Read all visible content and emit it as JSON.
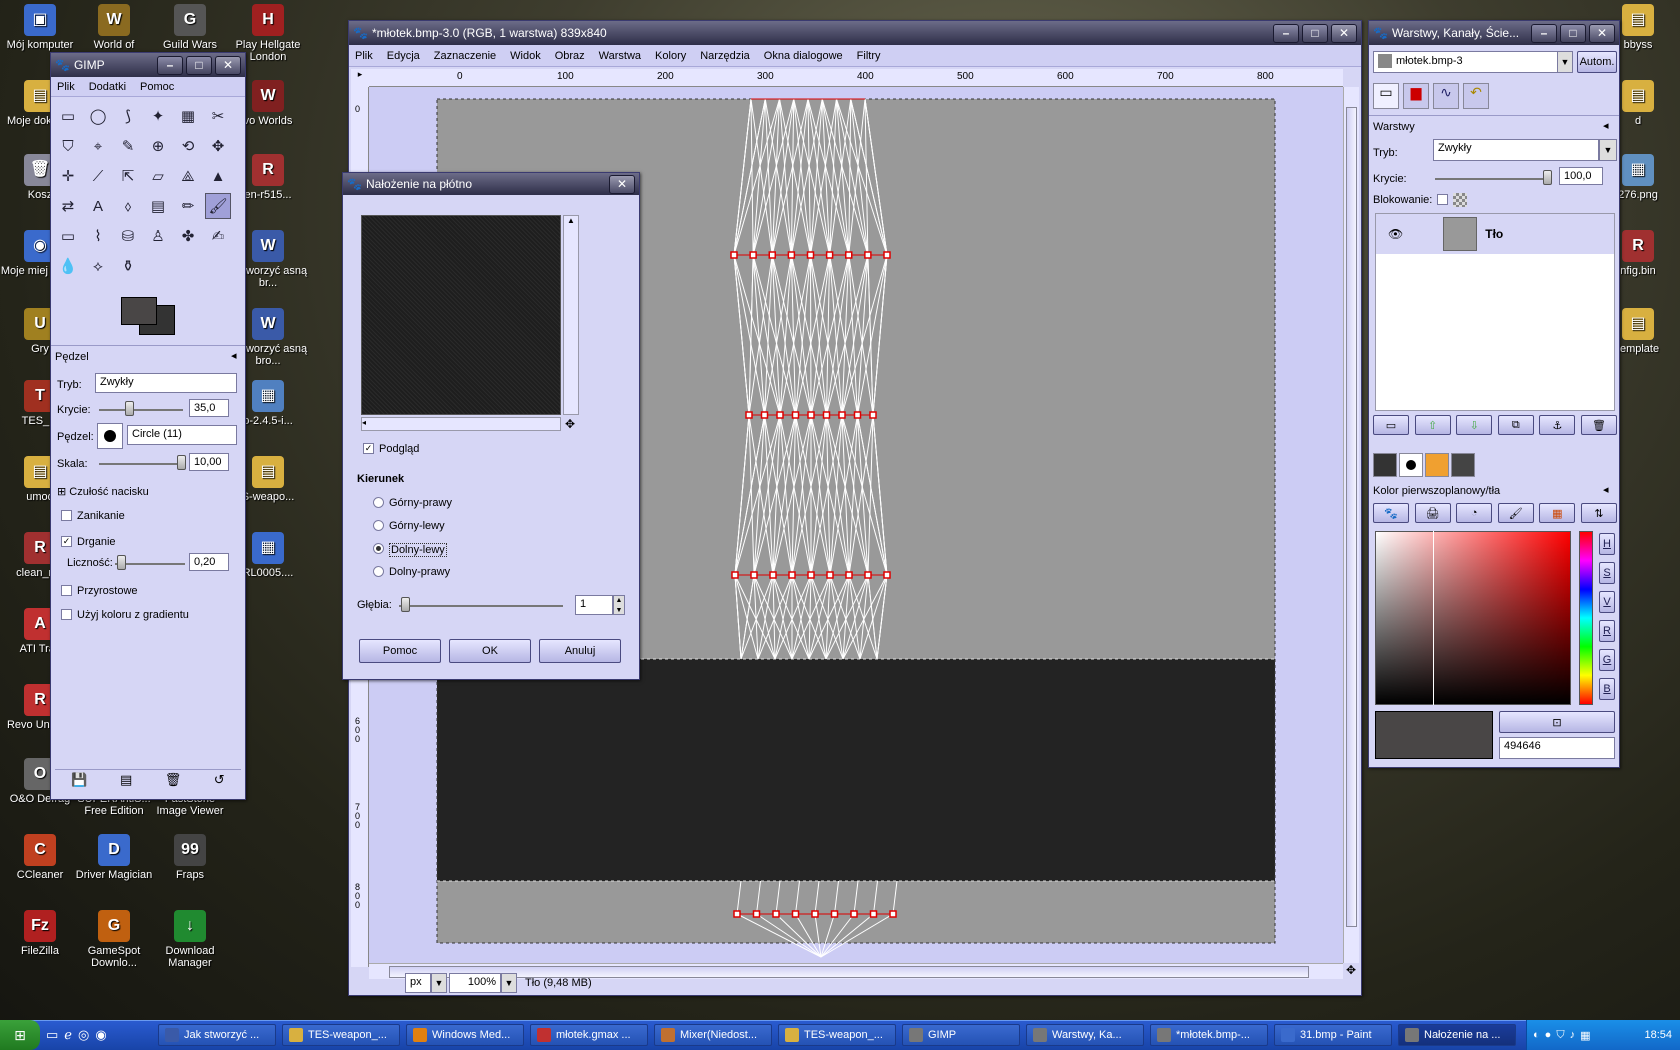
{
  "desktop": {
    "icons": [
      {
        "label": "Mój komputer",
        "color": "#3a6acc",
        "glyph": "▣"
      },
      {
        "label": "World of",
        "color": "#8a6a20",
        "glyph": "W"
      },
      {
        "label": "Guild Wars",
        "color": "#555555",
        "glyph": "G"
      },
      {
        "label": "Play Hellgate London",
        "color": "#a02020",
        "glyph": "H"
      },
      {
        "label": "Moje dokume",
        "color": "#d8b040",
        "glyph": "▤"
      },
      {
        "label": "vo Worlds",
        "color": "#802020",
        "glyph": "W"
      },
      {
        "label": "Kosz",
        "color": "#889",
        "glyph": "🗑"
      },
      {
        "label": "en-r515...",
        "color": "#a03030",
        "glyph": "R"
      },
      {
        "label": "Moje miej siecio",
        "color": "#3a6acc",
        "glyph": "◉"
      },
      {
        "label": "k stworzyć asną br...",
        "color": "#3a5aa8",
        "glyph": "W"
      },
      {
        "label": "Gry",
        "color": "#a08020",
        "glyph": "U"
      },
      {
        "label": "k stworzyć asną bro...",
        "color": "#3a5aa8",
        "glyph": "W"
      },
      {
        "label": "TES_M",
        "color": "#a03020",
        "glyph": "T"
      },
      {
        "label": "o-2.4.5-i...",
        "color": "#5080c0",
        "glyph": "▦"
      },
      {
        "label": "umod",
        "color": "#d8b040",
        "glyph": "▤"
      },
      {
        "label": "S-weapo...",
        "color": "#d8b040",
        "glyph": "▤"
      },
      {
        "label": "clean_rec",
        "color": "#a03030",
        "glyph": "R"
      },
      {
        "label": "RL0005....",
        "color": "#3a6acc",
        "glyph": "▦"
      },
      {
        "label": "ATI Tray",
        "color": "#c03030",
        "glyph": "A"
      },
      {
        "label": "Revo Uninsta",
        "color": "#c03030",
        "glyph": "R"
      },
      {
        "label": "O&O Defrag",
        "color": "#666",
        "glyph": "O"
      },
      {
        "label": "SUPERAntiS... Free Edition",
        "color": "#c03030",
        "glyph": "S"
      },
      {
        "label": "FastStone Image Viewer",
        "color": "#c04040",
        "glyph": "F"
      },
      {
        "label": "CCleaner",
        "color": "#c04020",
        "glyph": "C"
      },
      {
        "label": "Driver Magician",
        "color": "#3a6acc",
        "glyph": "D"
      },
      {
        "label": "Fraps",
        "color": "#444",
        "glyph": "99"
      },
      {
        "label": "FileZilla",
        "color": "#b02020",
        "glyph": "Fz"
      },
      {
        "label": "GameSpot Downlo...",
        "color": "#c06010",
        "glyph": "G"
      },
      {
        "label": "Download Manager",
        "color": "#208a30",
        "glyph": "↓"
      },
      {
        "label": "bbyss",
        "color": "#d8b040",
        "glyph": "▤"
      },
      {
        "label": "d",
        "color": "#d8b040",
        "glyph": "▤"
      },
      {
        "label": "276.png",
        "color": "#6090c0",
        "glyph": "▦"
      },
      {
        "label": "nfig.bin",
        "color": "#a03030",
        "glyph": "R"
      },
      {
        "label": "template",
        "color": "#d8b040",
        "glyph": "▤"
      }
    ]
  },
  "toolbox": {
    "title": "GIMP",
    "menu": [
      "Plik",
      "Dodatki",
      "Pomoc"
    ],
    "tool_options_title": "Pędzel",
    "mode_label": "Tryb:",
    "mode_value": "Zwykły",
    "opacity_label": "Krycie:",
    "opacity_value": "35,0",
    "brush_label": "Pędzel:",
    "brush_value": "Circle (11)",
    "scale_label": "Skala:",
    "scale_value": "10,00",
    "pressure_label": "Czułość nacisku",
    "fade_label": "Zanikanie",
    "jitter_label": "Drganie",
    "jitter_amount_label": "Liczność:",
    "jitter_amount_value": "0,20",
    "incremental_label": "Przyrostowe",
    "gradient_label": "Użyj koloru z gradientu"
  },
  "image_window": {
    "title": "*młotek.bmp-3.0 (RGB, 1 warstwa) 839x840",
    "menu": [
      "Plik",
      "Edycja",
      "Zaznaczenie",
      "Widok",
      "Obraz",
      "Warstwa",
      "Kolory",
      "Narzędzia",
      "Okna dialogowe",
      "Filtry"
    ],
    "ruler_ticks": [
      "0",
      "100",
      "200",
      "300",
      "400",
      "500",
      "600",
      "700",
      "800"
    ],
    "vruler_ticks": [
      "0",
      "6 0 0",
      "7 0 0",
      "8 0 0"
    ],
    "unit": "px",
    "zoom": "100%",
    "status": "Tło (9,48 MB)"
  },
  "dialog": {
    "title": "Nałożenie na płótno",
    "preview_label": "Podgląd",
    "direction_title": "Kierunek",
    "directions": [
      "Górny-prawy",
      "Górny-lewy",
      "Dolny-lewy",
      "Dolny-prawy"
    ],
    "selected_direction": 2,
    "depth_label": "Głębia:",
    "depth_value": "1",
    "help_label": "Pomoc",
    "ok_label": "OK",
    "cancel_label": "Anuluj"
  },
  "layers_window": {
    "title": "Warstwy, Kanały, Ście...",
    "image_select": "młotek.bmp-3",
    "auto_label": "Autom.",
    "panel_title": "Warstwy",
    "mode_label": "Tryb:",
    "mode_value": "Zwykły",
    "opacity_label": "Krycie:",
    "opacity_value": "100,0",
    "lock_label": "Blokowanie:",
    "layer_name": "Tło",
    "color_title": "Kolor pierwszoplanowy/tła",
    "channel_buttons": [
      "H",
      "S",
      "V",
      "R",
      "G",
      "B"
    ],
    "hex_value": "494646"
  },
  "taskbar": {
    "items": [
      {
        "label": "Jak stworzyć ...",
        "color": "#3a5aa8"
      },
      {
        "label": "TES-weapon_...",
        "color": "#d8b040"
      },
      {
        "label": "Windows Med...",
        "color": "#e08010"
      },
      {
        "label": "młotek.gmax ...",
        "color": "#c03030"
      },
      {
        "label": "Mixer(Niedost...",
        "color": "#c07030"
      },
      {
        "label": "TES-weapon_...",
        "color": "#d8b040"
      },
      {
        "label": "GIMP",
        "color": "#777"
      },
      {
        "label": "Warstwy, Ka...",
        "color": "#777"
      },
      {
        "label": "*młotek.bmp-...",
        "color": "#777"
      },
      {
        "label": "31.bmp - Paint",
        "color": "#3a6acc"
      },
      {
        "label": "Nałożenie na ...",
        "color": "#777"
      }
    ],
    "clock": "18:54"
  },
  "colors": {
    "fg": "#494646",
    "bg": "#333333",
    "window_bg": "#d6d6f5",
    "canvas_gray": "#999999",
    "canvas_dark": "#232323",
    "accent_red": "#dd0000"
  }
}
